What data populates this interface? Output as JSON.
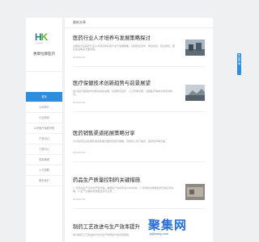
{
  "brand": {
    "logo_h": "H",
    "logo_k": "K",
    "logo_sub": "HUIKANG",
    "name": "惠康恒康医药"
  },
  "nav": {
    "items": [
      {
        "label": "首页"
      },
      {
        "label": "公司简介"
      },
      {
        "label": "行业新闻"
      },
      {
        "label": "公司医疗保健学院"
      },
      {
        "label": "产品中心"
      },
      {
        "label": "工程中心"
      },
      {
        "label": "质量管理"
      },
      {
        "label": "人才招聘"
      },
      {
        "label": "联系我们"
      }
    ]
  },
  "main": {
    "section_title": "最新文章",
    "articles": [
      {
        "title": "医药行业人才培养与发展策略探讨",
        "summary": "主要探讨在医药行业人才培养的实践方法与发展策略，包括校企合作、岗位培训、职业规划、团队建设等多方面内容。",
        "meta": "2019-06-26"
      },
      {
        "title": "医疗保健技术创新趋势与前景展望",
        "summary": "探讨医疗保健技术创新的最新进展，包括数字医疗、人工智能诊断、远程医疗等技术的应用前景。",
        "meta": "2019-06-26"
      },
      {
        "title": "医药销售渠道拓展策略分享",
        "summary": "分享医药企业在销售渠道拓展方面的经验与策略，包括线上线下融合、渠道合作等方面。",
        "meta": "2019-06-26"
      },
      {
        "title": "药品生产质量控制的关键措施",
        "summary": "1. 对药品生产环境的严格管理，确保生产车间符合GMP标准；2. 原材料的质量检测与供应商管理；3. 生产过程中的质量监控与记录。",
        "meta": "2019-06-26"
      },
      {
        "title": "制药工艺改进与生产效率提升",
        "summary": "探讨制药工艺改进的方法与生产效率提升的关键措施。",
        "meta": ""
      }
    ]
  },
  "side_tab": {
    "label": "在线咨询"
  },
  "watermark": {
    "text": "聚集网",
    "sub": "jujiwang.com"
  }
}
